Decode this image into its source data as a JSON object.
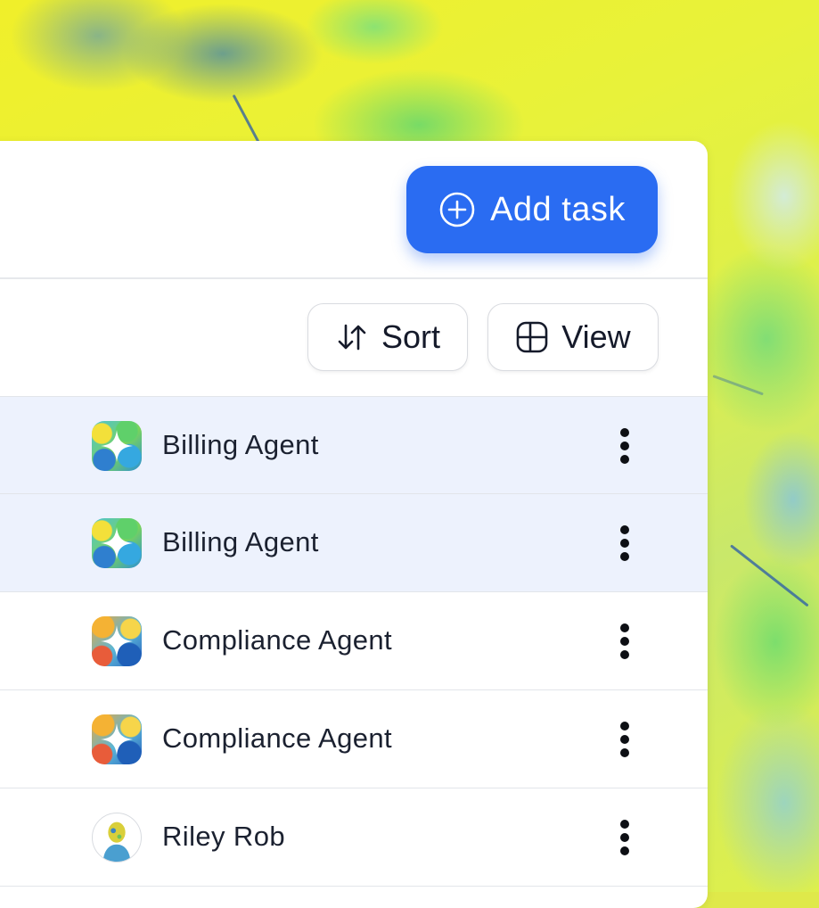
{
  "toolbar": {
    "add_task_label": "Add task",
    "sort_label": "Sort",
    "view_label": "View"
  },
  "rows": [
    {
      "name": "Billing Agent",
      "avatar": "billing-agent-avatar",
      "selected": true
    },
    {
      "name": "Billing Agent",
      "avatar": "billing-agent-avatar",
      "selected": true
    },
    {
      "name": "Compliance Agent",
      "avatar": "compliance-agent-avatar",
      "selected": false
    },
    {
      "name": "Compliance Agent",
      "avatar": "compliance-agent-avatar",
      "selected": false
    },
    {
      "name": "Riley Rob",
      "avatar": "person-avatar",
      "selected": false
    }
  ],
  "colors": {
    "accent": "#2a6cf2",
    "selected_row": "#edf2fd",
    "text": "#1b2130"
  },
  "icons": {
    "add": "plus-circle-icon",
    "sort": "sort-arrows-icon",
    "view": "grid-view-icon",
    "row_menu": "kebab-menu-icon"
  }
}
